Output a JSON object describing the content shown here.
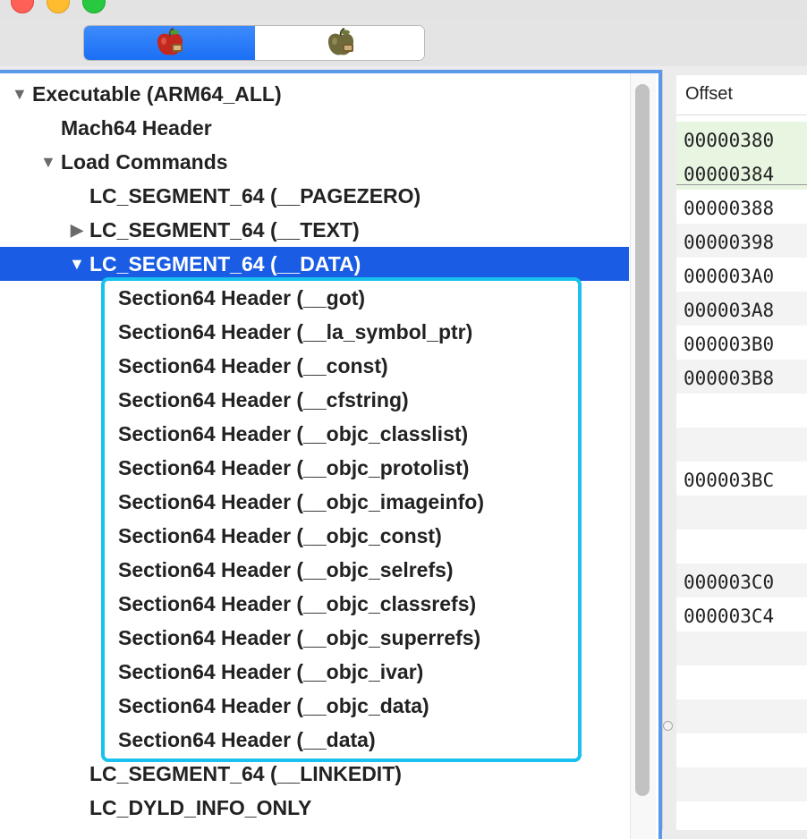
{
  "toolbar": {
    "segments": [
      {
        "name": "raw-view-icon",
        "state": "active"
      },
      {
        "name": "rva-view-icon",
        "state": "inactive"
      }
    ]
  },
  "tree": {
    "root": {
      "label": "Executable  (ARM64_ALL)"
    },
    "mach_header": {
      "label": "Mach64 Header"
    },
    "load_commands": {
      "label": "Load Commands"
    },
    "pagezero": {
      "label": "LC_SEGMENT_64 (__PAGEZERO)"
    },
    "text": {
      "label": "LC_SEGMENT_64 (__TEXT)"
    },
    "data": {
      "label": "LC_SEGMENT_64 (__DATA)"
    },
    "sections": [
      "Section64 Header (__got)",
      "Section64 Header (__la_symbol_ptr)",
      "Section64 Header (__const)",
      "Section64 Header (__cfstring)",
      "Section64 Header (__objc_classlist)",
      "Section64 Header (__objc_protolist)",
      "Section64 Header (__objc_imageinfo)",
      "Section64 Header (__objc_const)",
      "Section64 Header (__objc_selrefs)",
      "Section64 Header (__objc_classrefs)",
      "Section64 Header (__objc_superrefs)",
      "Section64 Header (__objc_ivar)",
      "Section64 Header (__objc_data)",
      "Section64 Header (__data)"
    ],
    "linkedit": {
      "label": "LC_SEGMENT_64 (__LINKEDIT)"
    },
    "dyld_info": {
      "label": "LC_DYLD_INFO_ONLY"
    }
  },
  "offsets": {
    "header": "Offset",
    "rows": [
      "00000380",
      "00000384",
      "00000388",
      "00000398",
      "000003A0",
      "000003A8",
      "000003B0",
      "000003B8",
      "",
      "",
      "000003BC",
      "",
      "",
      "000003C0",
      "000003C4",
      "",
      "",
      "",
      "",
      "",
      ""
    ]
  },
  "colors": {
    "selection": "#1a5ce4",
    "highlight_border": "#18c1ee",
    "offset_highlight": "#e7f5e1"
  }
}
